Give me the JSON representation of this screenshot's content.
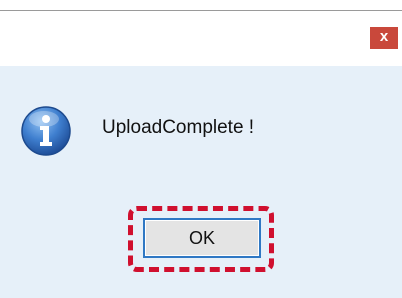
{
  "dialog": {
    "close_label": "x",
    "message": "UploadComplete !",
    "ok_label": "OK",
    "icon": "info-icon"
  },
  "colors": {
    "close_button_bg": "#c9483b",
    "content_bg": "#e6f0f9",
    "button_border": "#2f78c4",
    "focus_ring": "#d0102f"
  }
}
